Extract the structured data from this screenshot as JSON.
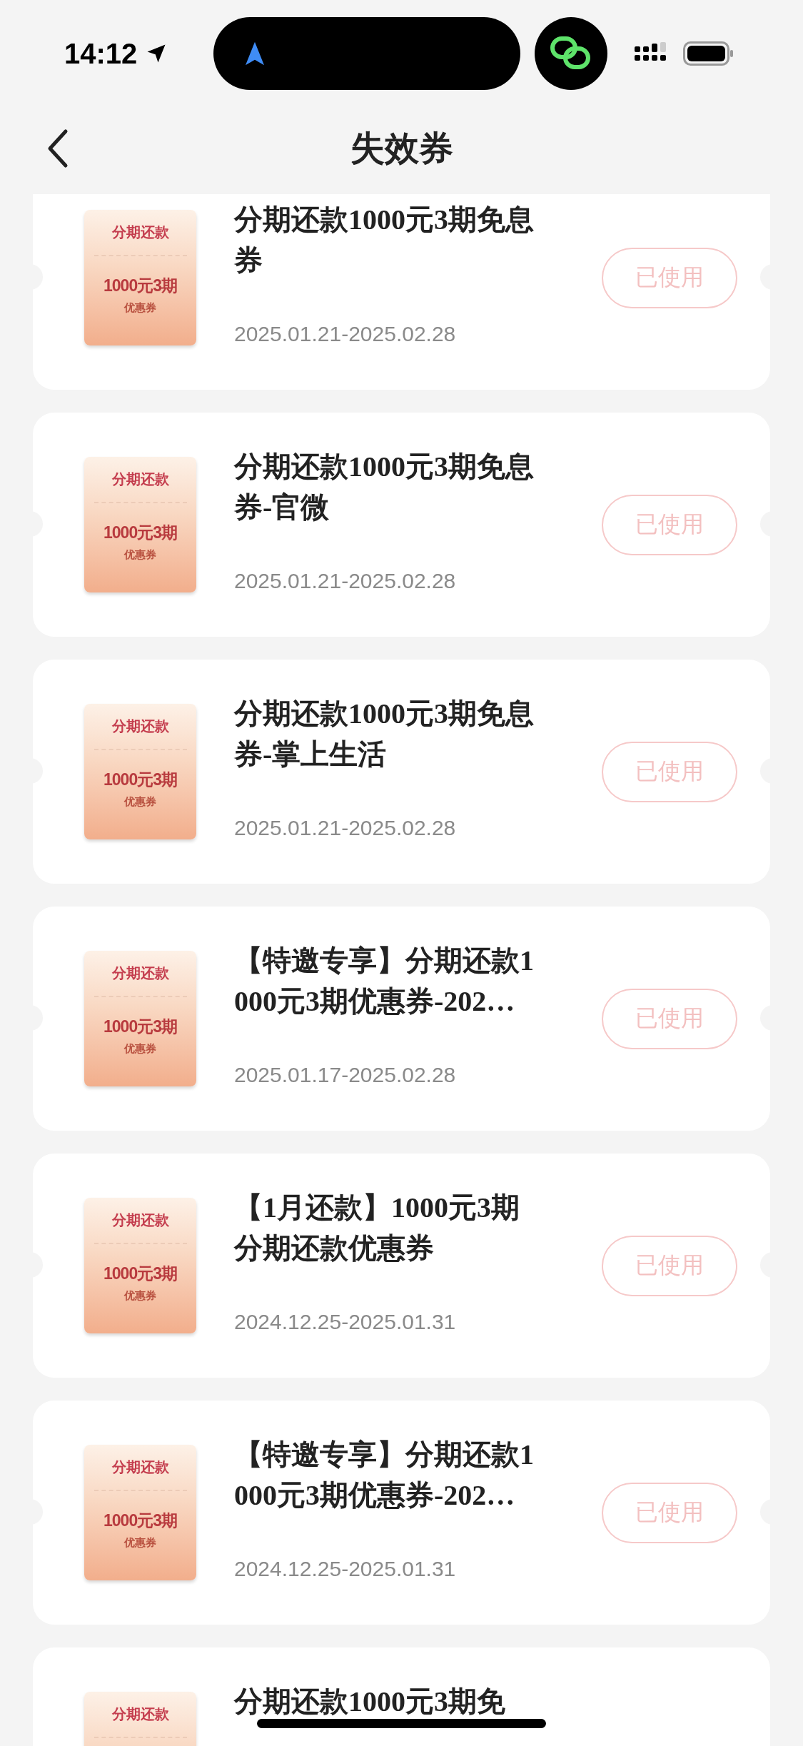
{
  "status_bar": {
    "time": "14:12"
  },
  "nav": {
    "title": "失效券"
  },
  "coupons": [
    {
      "badge": {
        "top": "分期还款",
        "amount": "1000元3期",
        "label": "优惠券"
      },
      "title": "分期还款1000元3期免息券",
      "date": "2025.01.21-2025.02.28",
      "status": "已使用"
    },
    {
      "badge": {
        "top": "分期还款",
        "amount": "1000元3期",
        "label": "优惠券"
      },
      "title": "分期还款1000元3期免息券-官微",
      "date": "2025.01.21-2025.02.28",
      "status": "已使用"
    },
    {
      "badge": {
        "top": "分期还款",
        "amount": "1000元3期",
        "label": "优惠券"
      },
      "title": "分期还款1000元3期免息券-掌上生活",
      "date": "2025.01.21-2025.02.28",
      "status": "已使用"
    },
    {
      "badge": {
        "top": "分期还款",
        "amount": "1000元3期",
        "label": "优惠券"
      },
      "title": "【特邀专享】分期还款1000元3期优惠券-202…",
      "date": "2025.01.17-2025.02.28",
      "status": "已使用"
    },
    {
      "badge": {
        "top": "分期还款",
        "amount": "1000元3期",
        "label": "优惠券"
      },
      "title": "【1月还款】1000元3期分期还款优惠券",
      "date": "2024.12.25-2025.01.31",
      "status": "已使用"
    },
    {
      "badge": {
        "top": "分期还款",
        "amount": "1000元3期",
        "label": "优惠券"
      },
      "title": "【特邀专享】分期还款1000元3期优惠券-202…",
      "date": "2024.12.25-2025.01.31",
      "status": "已使用"
    },
    {
      "badge": {
        "top": "分期还款"
      },
      "title": "分期还款1000元3期免"
    }
  ]
}
